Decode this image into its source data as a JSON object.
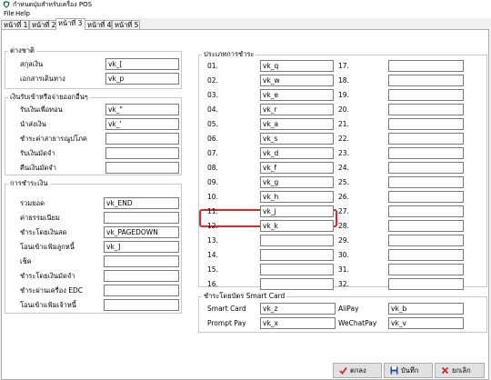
{
  "window": {
    "title": "กำหนดปุ่มสำหรับเครื่อง POS",
    "icon": "app-shield-icon"
  },
  "menu": [
    {
      "label": "File"
    },
    {
      "label": "Help"
    }
  ],
  "tabs": [
    {
      "label": "หน้าที่ 1"
    },
    {
      "label": "หน้าที่ 2"
    },
    {
      "label": "หน้าที่ 3"
    },
    {
      "label": "หน้าที่ 4"
    },
    {
      "label": "หน้าที่ 5"
    }
  ],
  "active_tab": "หน้าที่ 3",
  "groups": {
    "misc": {
      "title": "ต่างชาติ",
      "fields": [
        {
          "label": "สกุลเงิน",
          "value": "vk_["
        },
        {
          "label": "เอกสารเดินทาง",
          "value": "vk_p"
        }
      ]
    },
    "cash": {
      "title": "เงินรับเข้าหรือจ่ายออกอื่นๆ",
      "fields": [
        {
          "label": "รับเงินเพื่อทอน",
          "value": "vk_\""
        },
        {
          "label": "นำส่งเงิน",
          "value": "vk_'"
        },
        {
          "label": "ชำระค่าสาธารณูปโภค",
          "value": ""
        },
        {
          "label": "รับเงินมัดจำ",
          "value": ""
        },
        {
          "label": "คืนเงินมัดจำ",
          "value": ""
        }
      ]
    },
    "payment": {
      "title": "การชำระเงิน",
      "fields": [
        {
          "label": "รวมยอด",
          "value": "vk_END"
        },
        {
          "label": "ค่าธรรมเนียม",
          "value": ""
        },
        {
          "label": "ชำระโดยเงินสด",
          "value": "vk_PAGEDOWN"
        },
        {
          "label": "โอนเข้าแฟ้มลูกหนี้",
          "value": "vk_]"
        },
        {
          "label": "เช็ค",
          "value": ""
        },
        {
          "label": "ชำระโดยเงินมัดจำ",
          "value": ""
        },
        {
          "label": "ชำระผ่านเครื่อง EDC",
          "value": ""
        },
        {
          "label": "โอนเข้าแฟ้มเจ้าหนี้",
          "value": ""
        }
      ]
    },
    "payment_types": {
      "title": "ประเภทการชำระ",
      "left": [
        {
          "label": "01.",
          "value": "vk_q"
        },
        {
          "label": "02.",
          "value": "vk_w"
        },
        {
          "label": "03.",
          "value": "vk_e"
        },
        {
          "label": "04.",
          "value": "vk_r"
        },
        {
          "label": "05.",
          "value": "vk_a"
        },
        {
          "label": "06.",
          "value": "vk_s"
        },
        {
          "label": "07.",
          "value": "vk_d"
        },
        {
          "label": "08.",
          "value": "vk_f"
        },
        {
          "label": "09.",
          "value": "vk_g"
        },
        {
          "label": "10.",
          "value": "vk_h"
        },
        {
          "label": "11.",
          "value": "vk_j"
        },
        {
          "label": "12.",
          "value": "vk_k"
        },
        {
          "label": "13.",
          "value": ""
        },
        {
          "label": "14.",
          "value": ""
        },
        {
          "label": "15.",
          "value": ""
        },
        {
          "label": "16.",
          "value": ""
        }
      ],
      "right": [
        {
          "label": "17.",
          "value": ""
        },
        {
          "label": "18.",
          "value": ""
        },
        {
          "label": "19.",
          "value": ""
        },
        {
          "label": "20.",
          "value": ""
        },
        {
          "label": "21.",
          "value": ""
        },
        {
          "label": "22.",
          "value": ""
        },
        {
          "label": "23.",
          "value": ""
        },
        {
          "label": "24.",
          "value": ""
        },
        {
          "label": "25.",
          "value": ""
        },
        {
          "label": "26.",
          "value": ""
        },
        {
          "label": "27.",
          "value": ""
        },
        {
          "label": "28.",
          "value": ""
        },
        {
          "label": "29.",
          "value": ""
        },
        {
          "label": "30.",
          "value": ""
        },
        {
          "label": "31.",
          "value": ""
        },
        {
          "label": "32.",
          "value": ""
        }
      ],
      "highlighted": "12."
    },
    "smart_card": {
      "title": "ชำระโดยบัตร Smart Card",
      "rows": [
        {
          "l_label": "Smart Card",
          "l_value": "vk_z",
          "r_label": "AliPay",
          "r_value": "vk_b"
        },
        {
          "l_label": "Prompt Pay",
          "l_value": "vk_x",
          "r_label": "WeChatPay",
          "r_value": "vk_v"
        }
      ]
    }
  },
  "buttons": {
    "ok": "ตกลง",
    "save": "บันทึก",
    "cancel": "ยกเลิก"
  },
  "colors": {
    "highlight": "#d9262b",
    "ok_check": "#d21f1f",
    "cancel_x": "#d21f1f",
    "save_disk": "#2b4c8c"
  }
}
